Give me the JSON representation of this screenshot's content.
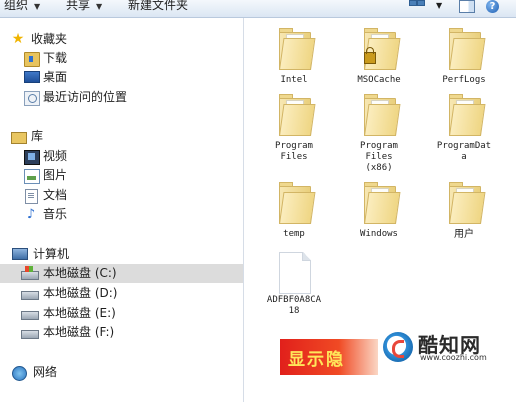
{
  "toolbar": {
    "organize_label": "组织",
    "share_label": "共享",
    "new_folder_label": "新建文件夹",
    "help_label": "?"
  },
  "nav": {
    "favorites": {
      "label": "收藏夹",
      "items": [
        {
          "label": "下载",
          "icon": "download-folder-icon"
        },
        {
          "label": "桌面",
          "icon": "desktop-icon"
        },
        {
          "label": "最近访问的位置",
          "icon": "recent-places-icon"
        }
      ]
    },
    "libraries": {
      "label": "库",
      "items": [
        {
          "label": "视频",
          "icon": "video-library-icon"
        },
        {
          "label": "图片",
          "icon": "pictures-library-icon"
        },
        {
          "label": "文档",
          "icon": "documents-library-icon"
        },
        {
          "label": "音乐",
          "icon": "music-library-icon"
        }
      ]
    },
    "computer": {
      "label": "计算机",
      "drives": [
        {
          "label": "本地磁盘 (C:)",
          "selected": true
        },
        {
          "label": "本地磁盘 (D:)",
          "selected": false
        },
        {
          "label": "本地磁盘 (E:)",
          "selected": false
        },
        {
          "label": "本地磁盘 (F:)",
          "selected": false
        }
      ]
    },
    "network": {
      "label": "网络"
    }
  },
  "content": {
    "items": [
      {
        "label": "Intel",
        "type": "folder"
      },
      {
        "label": "MSOCache",
        "type": "folder",
        "locked": true
      },
      {
        "label": "PerfLogs",
        "type": "folder"
      },
      {
        "label": "Program\nFiles",
        "type": "folder"
      },
      {
        "label": "Program\nFiles\n(x86)",
        "type": "folder"
      },
      {
        "label": "ProgramDat\na",
        "type": "folder"
      },
      {
        "label": "temp",
        "type": "folder"
      },
      {
        "label": "Windows",
        "type": "folder"
      },
      {
        "label": "用户",
        "type": "folder"
      },
      {
        "label": "ADFBF0A8CA\n18",
        "type": "file"
      }
    ]
  },
  "watermark": {
    "brand": "酷知网",
    "url": "www.coozhi.com",
    "banner_text": "显示隐"
  }
}
